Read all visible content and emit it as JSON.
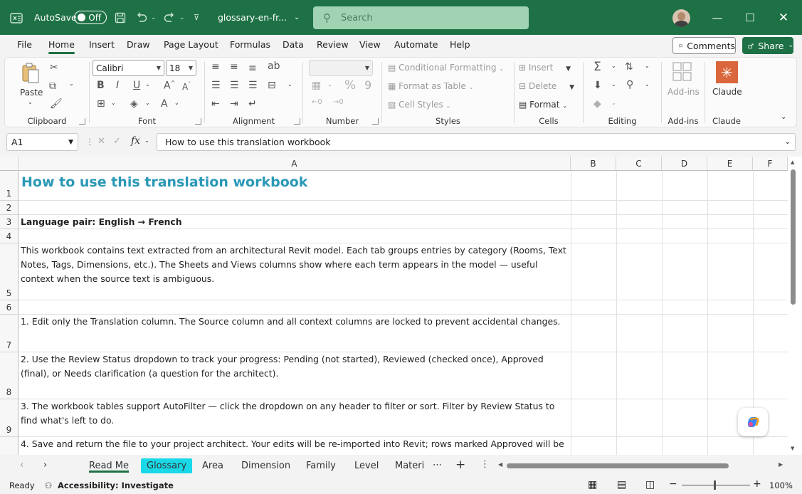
{
  "titlebar": {
    "autosave_label": "AutoSave",
    "autosave_state": "Off",
    "file_name": "glossary-en-fr...",
    "search_placeholder": "Search",
    "accent_color": "#1e7145"
  },
  "menu": {
    "tabs": [
      "File",
      "Home",
      "Insert",
      "Draw",
      "Page Layout",
      "Formulas",
      "Data",
      "Review",
      "View",
      "Automate",
      "Help"
    ],
    "active_tab": "Home",
    "comments_label": "Comments",
    "share_label": "Share"
  },
  "ribbon": {
    "clipboard": {
      "paste_label": "Paste",
      "group_label": "Clipboard"
    },
    "font": {
      "family": "Calibri",
      "size": "18",
      "group_label": "Font"
    },
    "alignment": {
      "group_label": "Alignment"
    },
    "number": {
      "group_label": "Number"
    },
    "styles": {
      "conditional_formatting": "Conditional Formatting",
      "format_as_table": "Format as Table",
      "cell_styles": "Cell Styles",
      "group_label": "Styles"
    },
    "cells": {
      "insert": "Insert",
      "delete": "Delete",
      "format": "Format",
      "group_label": "Cells"
    },
    "editing": {
      "group_label": "Editing"
    },
    "addins": {
      "label": "Add-ins",
      "group_label": "Add-ins"
    },
    "claude": {
      "label": "Claude",
      "group_label": "Claude",
      "color": "#d9663c"
    }
  },
  "formula_bar": {
    "name_box": "A1",
    "content": "How to use this translation workbook"
  },
  "grid": {
    "columns": [
      "A",
      "B",
      "C",
      "D",
      "E",
      "F"
    ],
    "rows": [
      {
        "num": "1",
        "text": "How to use this translation workbook",
        "style": "title"
      },
      {
        "num": "2",
        "text": ""
      },
      {
        "num": "3",
        "text": "Language pair: English → French",
        "style": "bold"
      },
      {
        "num": "4",
        "text": ""
      },
      {
        "num": "5",
        "text": "This workbook contains text extracted from an architectural Revit model. Each tab groups entries by category (Rooms, Text Notes, Tags, Dimensions, etc.). The Sheets and Views columns show where each term appears in the model — useful context when the source text is ambiguous."
      },
      {
        "num": "6",
        "text": ""
      },
      {
        "num": "7",
        "text": "1. Edit only the Translation column. The Source column and all context columns are locked to prevent accidental changes."
      },
      {
        "num": "8",
        "text": "2. Use the Review Status dropdown to track your progress: Pending (not started), Reviewed (checked once), Approved (final), or Needs clarification (a question for the architect)."
      },
      {
        "num": "9",
        "text": "3. The workbook tables support AutoFilter — click the dropdown on any header to filter or sort. Filter by Review Status to find what's left to do."
      },
      {
        "num": "",
        "text": "4. Save and return the file to your project architect. Your edits will be re-imported into Revit; rows marked Approved will be"
      }
    ]
  },
  "sheets": {
    "tabs": [
      "Read Me",
      "Glossary",
      "Area",
      "Dimension",
      "Family",
      "Level",
      "Materi"
    ],
    "active": "Read Me",
    "highlighted": "Glossary",
    "highlight_color": "#19d8e8"
  },
  "status": {
    "ready": "Ready",
    "accessibility": "Accessibility: Investigate",
    "zoom": "100%"
  }
}
